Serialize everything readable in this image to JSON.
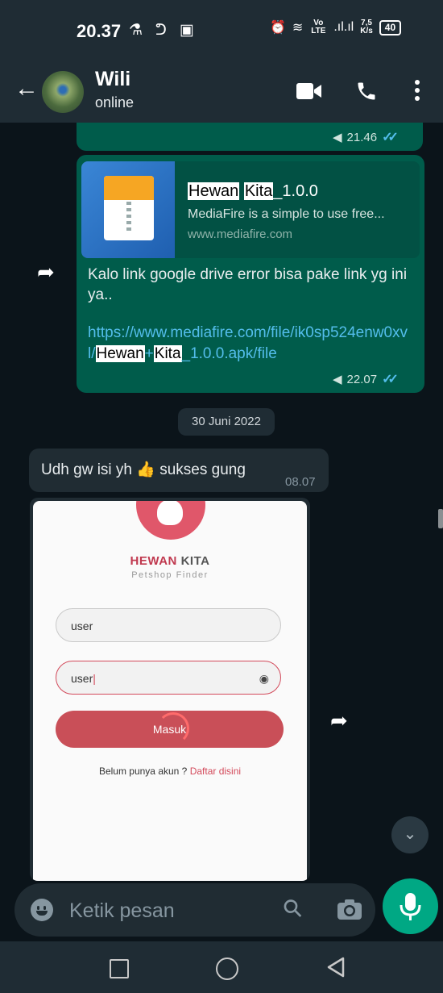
{
  "status_bar": {
    "time": "20.37",
    "net_speed_top": "7,5",
    "net_speed_bottom": "K/s",
    "battery": "40",
    "volte": "Vo LTE"
  },
  "header": {
    "contact_name": "Wili",
    "contact_status": "online"
  },
  "messages": {
    "first_time": "21.46",
    "link_preview": {
      "title_parts": [
        "Hewan",
        "Kita",
        "_1.0.0"
      ],
      "description": "MediaFire is a simple to use free...",
      "domain": "www.mediafire.com"
    },
    "link_message": {
      "text": "Kalo link google drive error bisa pake link yg ini ya..",
      "url_part1": "https://www.mediafire.com/file/ik0sp524enw0xvl/",
      "url_hl1": "Hewan",
      "url_plus": "+",
      "url_hl2": "Kita",
      "url_part2": "_1.0.0.apk/file",
      "time": "22.07"
    },
    "date_chip": "30 Juni 2022",
    "incoming": {
      "text_before": "Udh gw isi yh",
      "emoji": "👍",
      "text_after": "sukses gung",
      "time": "08.07"
    },
    "screenshot": {
      "brand_a": "HEWAN",
      "brand_b": "KITA",
      "tagline": "Petshop Finder",
      "username_value": "user",
      "password_value": "user",
      "login_label": "Masuk",
      "register_text": "Belum punya akun ?",
      "register_link": "Daftar disini"
    }
  },
  "input": {
    "placeholder": "Ketik pesan"
  },
  "colors": {
    "outgoing_bubble": "#005c4b",
    "incoming_bubble": "#202c33",
    "accent": "#00a884",
    "read_ticks": "#53bdeb"
  }
}
